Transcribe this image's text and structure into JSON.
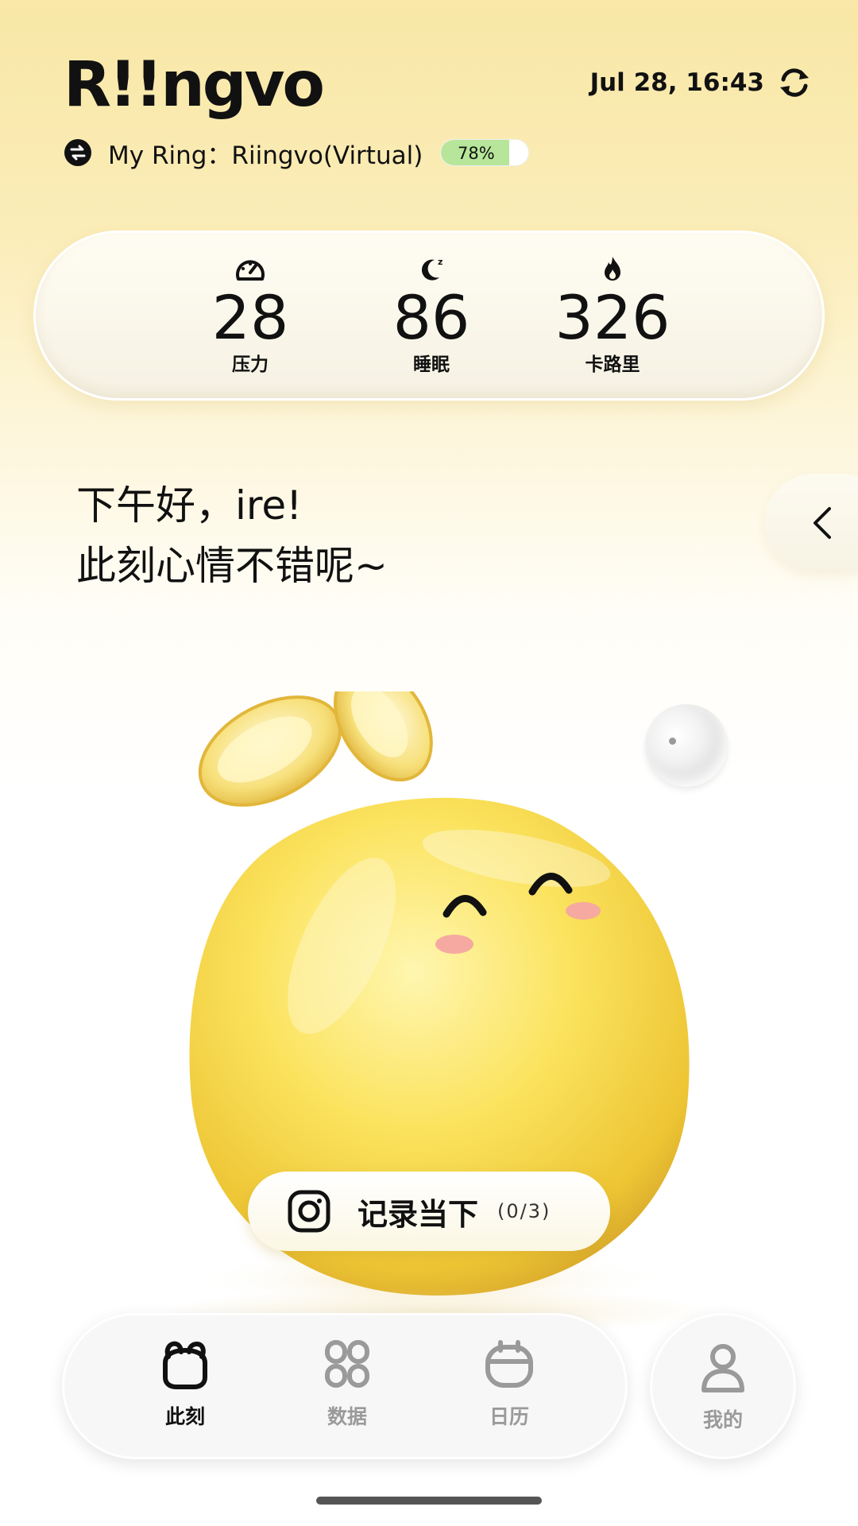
{
  "header": {
    "logo": "R!!ngvo",
    "datetime": "Jul 28, 16:43",
    "ring_label": "My Ring：Riingvo(Virtual)",
    "battery_text": "78%",
    "battery_level": 0.78
  },
  "stats": [
    {
      "icon": "speedometer-icon",
      "value": "28",
      "label": "压力"
    },
    {
      "icon": "moon-sleep-icon",
      "value": "86",
      "label": "睡眠"
    },
    {
      "icon": "flame-icon",
      "value": "326",
      "label": "卡路里"
    }
  ],
  "greeting": {
    "line1": "下午好，ire!",
    "line2": "此刻心情不错呢~"
  },
  "record": {
    "label": "记录当下",
    "count": "(0/3)"
  },
  "nav": {
    "items": [
      {
        "label": "此刻",
        "icon": "bunny-icon",
        "active": true
      },
      {
        "label": "数据",
        "icon": "grid-icon",
        "active": false
      },
      {
        "label": "日历",
        "icon": "calendar-icon",
        "active": false
      }
    ],
    "profile_label": "我的"
  },
  "colors": {
    "accent_yellow": "#f6d94a",
    "battery_green": "#b7e59a",
    "background_top": "#f8e7a6"
  }
}
